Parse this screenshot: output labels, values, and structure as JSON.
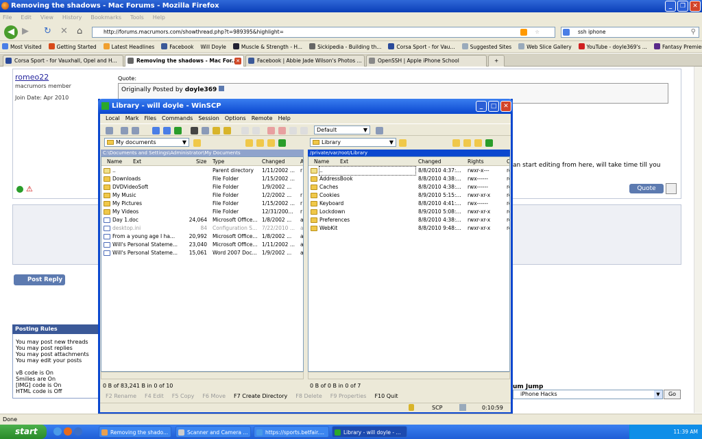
{
  "firefox": {
    "title": "Removing the shadows - Mac Forums - Mozilla Firefox",
    "menu": [
      "File",
      "Edit",
      "View",
      "History",
      "Bookmarks",
      "Tools",
      "Help"
    ],
    "url": "http://forums.macrumors.com/showthread.php?t=989395&highlight=",
    "search": "ssh iphone",
    "bookmarks": [
      "Most Visited",
      "Getting Started",
      "Latest Headlines",
      "Facebook",
      "Will Doyle",
      "Muscle & Strength - H...",
      "Sickipedia - Building th...",
      "Corsa Sport - for Vau...",
      "Suggested Sites",
      "Web Slice Gallery",
      "YouTube - doyle369's ...",
      "Fantasy Premier Leag..."
    ],
    "tabs": [
      "Corsa Sport - for Vauxhall, Opel and H...",
      "Removing the shadows - Mac For...",
      "Facebook | Abbie Jade Wilson's Photos ...",
      "OpenSSH | Apple iPhone School"
    ],
    "status": "Done"
  },
  "post": {
    "username": "romeo22",
    "rank": "macrumors member",
    "join": "Join Date: Apr 2010",
    "quote_label": "Quote:",
    "quote_by_prefix": "Originally Posted by",
    "quote_author": "doyle369",
    "partial_text": "an start editing from here, will take time till you",
    "quote_button": "Quote"
  },
  "reply_button": "Post Reply",
  "rules": {
    "title": "Posting Rules",
    "lines": [
      "You may post new threads",
      "You may post replies",
      "You may post attachments",
      "You may edit your posts"
    ],
    "codes": [
      "vB code is On",
      "Smilies are On",
      "[IMG] code is On",
      "HTML code is Off"
    ]
  },
  "forum_jump": {
    "label": "um Jump",
    "selected": "iPhone Hacks",
    "go": "Go"
  },
  "winscp": {
    "title": "Library - will doyle - WinSCP",
    "menu": [
      "Local",
      "Mark",
      "Files",
      "Commands",
      "Session",
      "Options",
      "Remote",
      "Help"
    ],
    "session": "Default",
    "left_dir": "My documents",
    "right_dir": "Library",
    "left_path": "C:\\Documents and Settings\\Administrator\\My Documents",
    "right_path": "/private/var/root/Library",
    "left_headers": [
      "Name",
      "Ext",
      "Size",
      "Type",
      "Changed",
      "A"
    ],
    "right_headers": [
      "Name",
      "Ext",
      "Changed",
      "Rights",
      "O"
    ],
    "left_files": [
      {
        "name": "..",
        "size": "",
        "type": "Parent directory",
        "changed": "1/11/2002 ...",
        "attr": "r"
      },
      {
        "name": "Downloads",
        "size": "",
        "type": "File Folder",
        "changed": "1/15/2002 ...",
        "attr": ""
      },
      {
        "name": "DVDVideoSoft",
        "size": "",
        "type": "File Folder",
        "changed": "1/9/2002 ...",
        "attr": ""
      },
      {
        "name": "My Music",
        "size": "",
        "type": "File Folder",
        "changed": "1/2/2002 ...",
        "attr": "r"
      },
      {
        "name": "My Pictures",
        "size": "",
        "type": "File Folder",
        "changed": "1/15/2002 ...",
        "attr": "r"
      },
      {
        "name": "My Videos",
        "size": "",
        "type": "File Folder",
        "changed": "12/31/200...",
        "attr": "r"
      },
      {
        "name": "Day 1.doc",
        "size": "24,064",
        "type": "Microsoft Office...",
        "changed": "1/8/2002 ...",
        "attr": "a"
      },
      {
        "name": "desktop.ini",
        "size": "84",
        "type": "Configuration S...",
        "changed": "7/22/2010 ...",
        "attr": "as"
      },
      {
        "name": "From a young age I ha...",
        "size": "20,992",
        "type": "Microsoft Office...",
        "changed": "1/8/2002 ...",
        "attr": "a"
      },
      {
        "name": "Will's Personal Stateme...",
        "size": "23,040",
        "type": "Microsoft Office...",
        "changed": "1/11/2002 ...",
        "attr": "a"
      },
      {
        "name": "Will's Personal Stateme...",
        "size": "15,061",
        "type": "Word 2007 Doc...",
        "changed": "1/9/2002 ...",
        "attr": "a"
      }
    ],
    "right_files": [
      {
        "name": "..",
        "changed": "8/8/2010 4:37:...",
        "rights": "rwxr-x---",
        "owner": "ro"
      },
      {
        "name": "AddressBook",
        "changed": "8/8/2010 4:38:...",
        "rights": "rwx------",
        "owner": "ro"
      },
      {
        "name": "Caches",
        "changed": "8/8/2010 4:38:...",
        "rights": "rwx------",
        "owner": "ro"
      },
      {
        "name": "Cookies",
        "changed": "8/9/2010 5:15:...",
        "rights": "rwxr-xr-x",
        "owner": "ro"
      },
      {
        "name": "Keyboard",
        "changed": "8/8/2010 4:41:...",
        "rights": "rwx------",
        "owner": "ro"
      },
      {
        "name": "Lockdown",
        "changed": "8/9/2010 5:08:...",
        "rights": "rwxr-xr-x",
        "owner": "ro"
      },
      {
        "name": "Preferences",
        "changed": "8/8/2010 4:38:...",
        "rights": "rwxr-xr-x",
        "owner": "ro"
      },
      {
        "name": "WebKit",
        "changed": "8/8/2010 9:48:...",
        "rights": "rwxr-xr-x",
        "owner": "ro"
      }
    ],
    "left_status": "0 B of 83,241 B in 0 of 10",
    "right_status": "0 B of 0 B in 0 of 7",
    "fkeys": [
      "F2 Rename",
      "F4 Edit",
      "F5 Copy",
      "F6 Move",
      "F7 Create Directory",
      "F8 Delete",
      "F9 Properties",
      "F10 Quit"
    ],
    "protocol": "SCP",
    "timer": "0:10:59"
  },
  "taskbar": {
    "start": "start",
    "items": [
      "Removing the shado...",
      "Scanner and Camera ...",
      "https://sports.betfair....",
      "Library - will doyle - ..."
    ],
    "clock": "11:39 AM"
  }
}
